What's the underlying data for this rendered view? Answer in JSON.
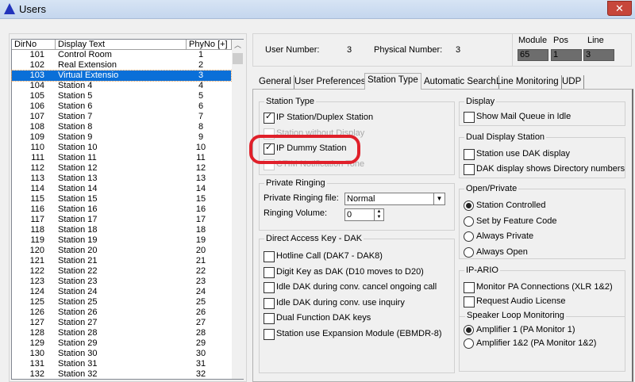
{
  "window": {
    "title": "Users",
    "close": "✕"
  },
  "list": {
    "headers": [
      "DirNo",
      "Display Text",
      "PhyNo [+]"
    ],
    "selected_index": 2,
    "rows": [
      [
        "101",
        "Control Room",
        "1"
      ],
      [
        "102",
        "Real Extension",
        "2"
      ],
      [
        "103",
        "Virtual Extensio",
        "3"
      ],
      [
        "104",
        "Station 4",
        "4"
      ],
      [
        "105",
        "Station 5",
        "5"
      ],
      [
        "106",
        "Station 6",
        "6"
      ],
      [
        "107",
        "Station 7",
        "7"
      ],
      [
        "108",
        "Station 8",
        "8"
      ],
      [
        "109",
        "Station 9",
        "9"
      ],
      [
        "110",
        "Station 10",
        "10"
      ],
      [
        "111",
        "Station 11",
        "11"
      ],
      [
        "112",
        "Station 12",
        "12"
      ],
      [
        "113",
        "Station 13",
        "13"
      ],
      [
        "114",
        "Station 14",
        "14"
      ],
      [
        "115",
        "Station 15",
        "15"
      ],
      [
        "116",
        "Station 16",
        "16"
      ],
      [
        "117",
        "Station 17",
        "17"
      ],
      [
        "118",
        "Station 18",
        "18"
      ],
      [
        "119",
        "Station 19",
        "19"
      ],
      [
        "120",
        "Station 20",
        "20"
      ],
      [
        "121",
        "Station 21",
        "21"
      ],
      [
        "122",
        "Station 22",
        "22"
      ],
      [
        "123",
        "Station 23",
        "23"
      ],
      [
        "124",
        "Station 24",
        "24"
      ],
      [
        "125",
        "Station 25",
        "25"
      ],
      [
        "126",
        "Station 26",
        "26"
      ],
      [
        "127",
        "Station 27",
        "27"
      ],
      [
        "128",
        "Station 28",
        "28"
      ],
      [
        "129",
        "Station 29",
        "29"
      ],
      [
        "130",
        "Station 30",
        "30"
      ],
      [
        "131",
        "Station 31",
        "31"
      ],
      [
        "132",
        "Station 32",
        "32"
      ]
    ]
  },
  "info": {
    "user_number_label": "User Number:",
    "user_number": "3",
    "physical_number_label": "Physical Number:",
    "physical_number": "3",
    "module_label": "Module",
    "module": "65",
    "pos_label": "Pos",
    "pos": "1",
    "line_label": "Line",
    "line": "3"
  },
  "tabs": [
    "General",
    "User Preferences",
    "Station Type",
    "Automatic Search",
    "Line Monitoring",
    "UDP"
  ],
  "active_tab": "Station Type",
  "station_type": {
    "label": "Station Type",
    "items": [
      {
        "label": "IP Station/Duplex Station",
        "checked": true
      },
      {
        "label": "Station without Display",
        "disabled": true
      },
      {
        "label": "IP Dummy Station",
        "checked": true
      },
      {
        "label": "CTIM Notification Tone",
        "disabled": true
      }
    ]
  },
  "display": {
    "label": "Display",
    "items": [
      "Show Mail Queue in Idle"
    ]
  },
  "dual_display": {
    "label": "Dual Display Station",
    "items": [
      "Station use DAK display",
      "DAK display shows Directory numbers"
    ]
  },
  "private_ringing": {
    "label": "Private Ringing",
    "file_label": "Private Ringing file:",
    "file_value": "Normal",
    "volume_label": "Ringing Volume:",
    "volume_value": "0"
  },
  "dak": {
    "label": "Direct Access Key - DAK",
    "items": [
      "Hotline Call (DAK7 - DAK8)",
      "Digit Key as DAK (D10 moves to D20)",
      "Idle DAK during conv. cancel ongoing call",
      "Idle DAK during conv. use inquiry",
      "Dual Function DAK keys",
      "Station use Expansion Module (EBMDR-8)"
    ]
  },
  "open_private": {
    "label": "Open/Private",
    "items": [
      "Station Controlled",
      "Set by Feature Code",
      "Always Private",
      "Always Open"
    ],
    "selected": "Station Controlled"
  },
  "ip_ario": {
    "label": "IP-ARIO",
    "items": [
      "Monitor PA Connections (XLR 1&2)",
      "Request Audio License"
    ],
    "speaker_label": "Speaker Loop Monitoring",
    "speaker_items": [
      "Amplifier 1 (PA Monitor 1)",
      "Amplifier 1&2 (PA Monitor 1&2)"
    ],
    "speaker_selected": "Amplifier 1 (PA Monitor 1)"
  },
  "colors": {
    "selection": "#0a6fd8",
    "highlight": "#e0202a"
  }
}
